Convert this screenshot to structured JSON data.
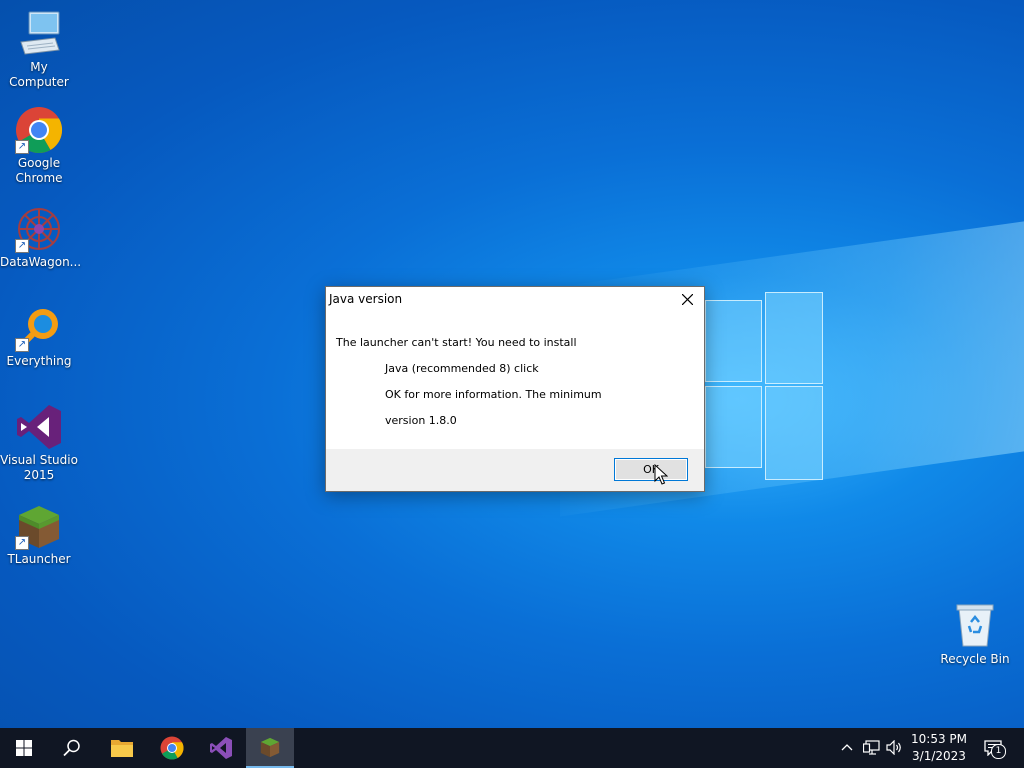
{
  "desktop": {
    "icons": [
      {
        "label": "My Computer"
      },
      {
        "label": "Google Chrome"
      },
      {
        "label": "DataWagon..."
      },
      {
        "label": "Everything"
      },
      {
        "label": "Visual Studio 2015"
      },
      {
        "label": "TLauncher"
      },
      {
        "label": "Recycle Bin"
      }
    ]
  },
  "dialog": {
    "title": "Java version",
    "message_lines": [
      "The launcher can't start! You need to install",
      "Java (recommended 8) click",
      "OK for more information. The minimum",
      "version 1.8.0"
    ],
    "ok_label": "OK"
  },
  "taskbar": {
    "pinned": [
      "start-icon",
      "search-icon",
      "file-explorer-icon",
      "chrome-icon",
      "visual-studio-icon",
      "tlauncher-icon"
    ],
    "clock": {
      "time": "10:53 PM",
      "date": "3/1/2023"
    },
    "notification_count": "1"
  },
  "colors": {
    "accent": "#0078d7",
    "taskbar": "#101623",
    "desktop": "#0a6fd6"
  }
}
